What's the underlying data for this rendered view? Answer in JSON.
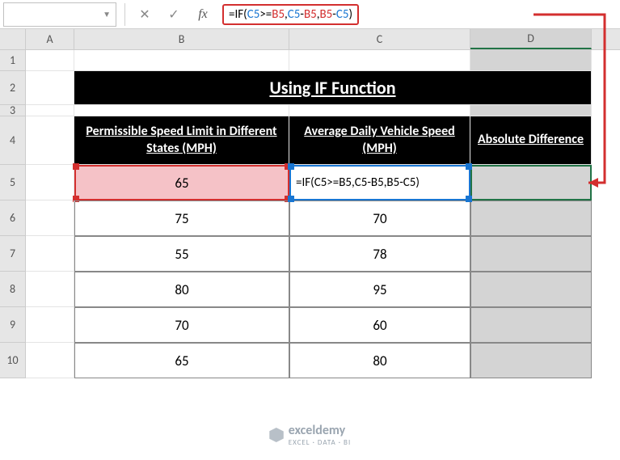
{
  "nameBox": "",
  "formula": {
    "eq": "=",
    "fn": "IF",
    "open": "(",
    "c5": "C5",
    "gte": ">=",
    "b5": "B5",
    "comma": ",",
    "minus": "-",
    "close": ")"
  },
  "columns": {
    "A": "A",
    "B": "B",
    "C": "C",
    "D": "D"
  },
  "rowNums": [
    "1",
    "2",
    "3",
    "4",
    "5",
    "6",
    "7",
    "8",
    "9",
    "10"
  ],
  "title": "Using IF Function",
  "headers": {
    "b": "Permissible Speed Limit in Different States (MPH)",
    "c": "Average Daily Vehicle Speed (MPH)",
    "d": "Absolute Difference"
  },
  "c5_editing": "=IF(C5>=B5,C5-B5,B5-C5)",
  "chart_data": {
    "type": "table",
    "columns": [
      "Permissible Speed Limit in Different States (MPH)",
      "Average Daily Vehicle Speed (MPH)",
      "Absolute Difference"
    ],
    "rows": [
      {
        "b": 65,
        "c": null,
        "d": null
      },
      {
        "b": 75,
        "c": 70,
        "d": null
      },
      {
        "b": 55,
        "c": 78,
        "d": null
      },
      {
        "b": 80,
        "c": 95,
        "d": null
      },
      {
        "b": 70,
        "c": 60,
        "d": null
      },
      {
        "b": 65,
        "c": 80,
        "d": null
      }
    ]
  },
  "watermark": {
    "brand": "exceldemy",
    "tagline": "EXCEL · DATA · BI"
  }
}
